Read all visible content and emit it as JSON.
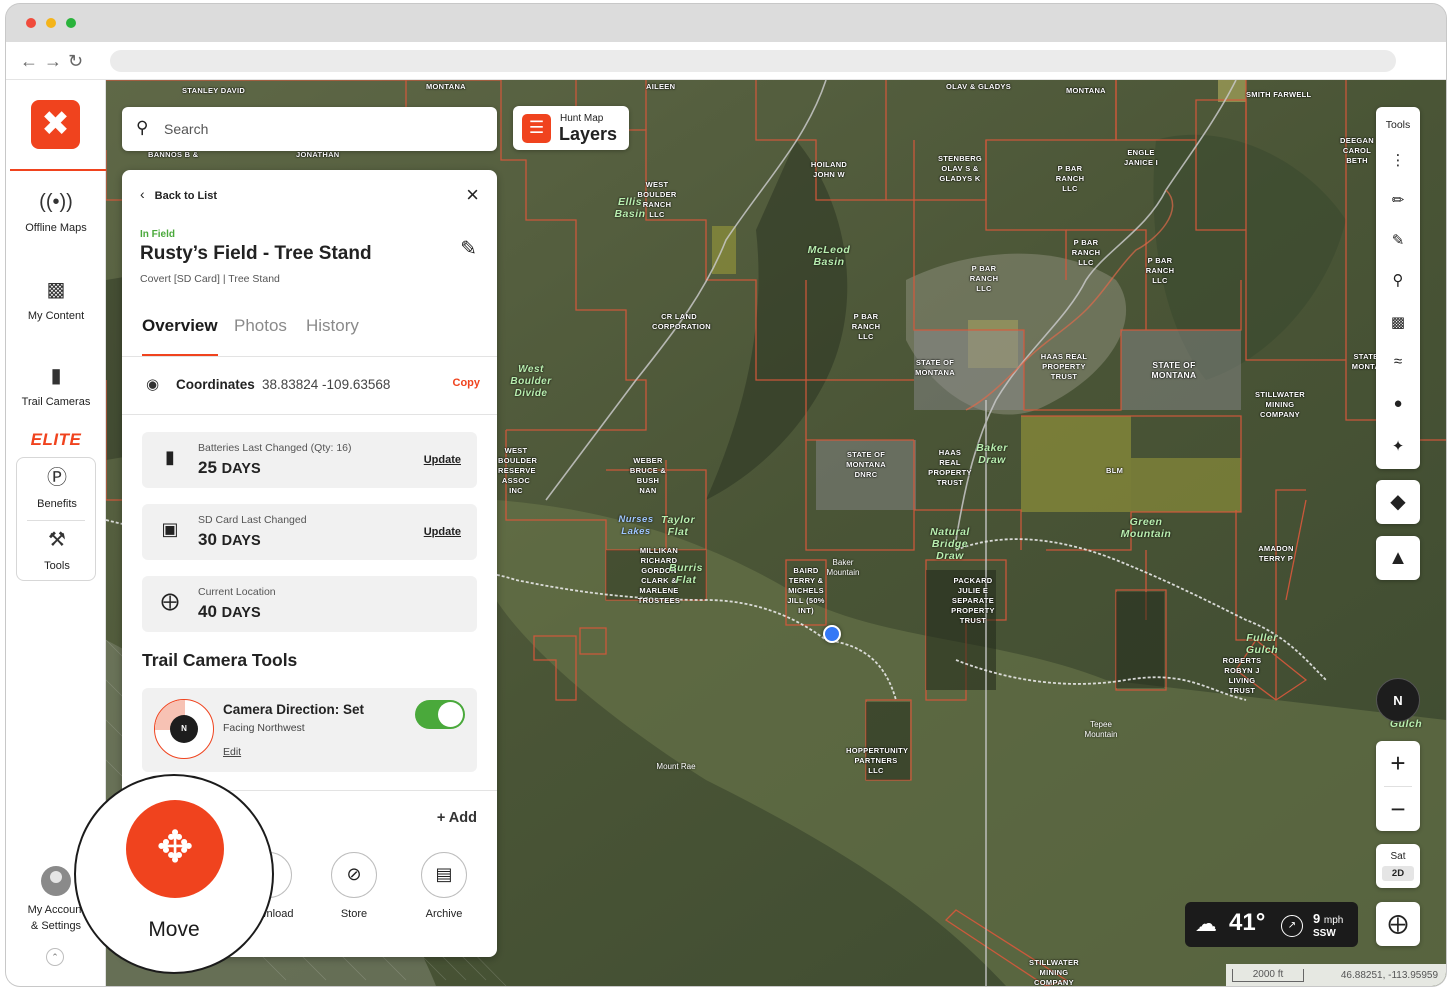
{
  "sidebar": {
    "items": [
      {
        "icon": "signal-icon",
        "label": "Offline Maps"
      },
      {
        "icon": "folder-icon",
        "label": "My Content"
      },
      {
        "icon": "trail-camera-icon",
        "label": "Trail Cameras"
      }
    ],
    "elite_label": "ELITE",
    "benefits_label": "Benefits",
    "tools_label": "Tools",
    "account_label_1": "My Account",
    "account_label_2": "& Settings"
  },
  "search": {
    "placeholder": "Search"
  },
  "layers": {
    "subtitle": "Hunt Map",
    "title": "Layers"
  },
  "detail": {
    "back_label": "Back to List",
    "status": "In Field",
    "title": "Rusty’s Field - Tree Stand",
    "subtitle": "Covert [SD Card] | Tree Stand",
    "tabs": [
      "Overview",
      "Photos",
      "History"
    ],
    "coordinates_label": "Coordinates",
    "coordinates_value": "38.83824  -109.63568",
    "copy_label": "Copy",
    "cards": [
      {
        "label": "Batteries Last Changed (Qty: 16)",
        "value": "25",
        "unit": "DAYS",
        "action": "Update"
      },
      {
        "label": "SD Card Last Changed",
        "value": "30",
        "unit": "DAYS",
        "action": "Update"
      },
      {
        "label": "Current Location",
        "value": "40",
        "unit": "DAYS",
        "action": ""
      }
    ],
    "tools_title": "Trail Camera Tools",
    "direction_title": "Camera Direction: Set",
    "direction_sub": "Facing Northwest",
    "direction_edit": "Edit",
    "compass_letter": "N",
    "add_label": "+ Add",
    "actions": [
      "Download",
      "Store",
      "Archive"
    ]
  },
  "move": {
    "label": "Move"
  },
  "tools_panel": {
    "title": "Tools"
  },
  "map_controls": {
    "north": "N",
    "sat_label": "Sat",
    "mode_2d": "2D",
    "zoom_in": "+",
    "zoom_out": "−"
  },
  "weather": {
    "temp": "41°",
    "speed": "9",
    "speed_unit": "mph",
    "direction": "SSW"
  },
  "scale": {
    "distance": "2000 ft",
    "cursor_coords": "46.88251, -113.95959"
  },
  "map_labels": [
    "STANLEY DAVID",
    "MONTANA",
    "AILEEN",
    "OLAV & GLADYS",
    "MONTANA",
    "SMITH FARWELL",
    "BANNOS B &",
    "JONATHAN",
    "HOILAND JOHN W",
    "STENBERG OLAV S & GLADYS K",
    "P BAR RANCH LLC",
    "ENGLE JANICE I",
    "DEEGAN CAROL BETH",
    "WEST BOULDER RANCH LLC",
    "P BAR RANCH LLC",
    "P BAR RANCH LLC",
    "P BAR RANCH LLC",
    "CR LAND CORPORATION",
    "P BAR RANCH LLC",
    "STATE OF MONTANA",
    "HAAS REAL PROPERTY TRUST",
    "STATE OF MONTANA",
    "STILLWATER MINING COMPANY",
    "STATE MONTA",
    "WEST BOULDER RESERVE ASSOC INC",
    "WEBER BRUCE & BUSH NAN",
    "STATE OF MONTANA DNRC",
    "HAAS REAL PROPERTY TRUST",
    "BLM",
    "MILLIKAN RICHARD GORDON CLARK & MARLENE TRUSTEES",
    "BAIRD TERRY & MICHELS JILL (50% INT)",
    "PACKARD JULIE E SEPARATE PROPERTY TRUST",
    "AMADON TERRY P",
    "ROBERTS ROBYN J LIVING TRUST",
    "HOPPERTUNITY PARTNERS LLC",
    "STILLWATER MINING COMPANY"
  ],
  "map_place_names": [
    "Ellis Basin",
    "McLeod Basin",
    "West Boulder Divide",
    "Nurses Lakes",
    "Taylor Flat",
    "Burris Flat",
    "Baker Draw",
    "Natural Bridge Draw",
    "Green Mountain",
    "Fuller Gulch",
    "Gulch"
  ],
  "map_terrain_names": [
    "Baker Mountain",
    "Tepee Mountain",
    "Mount Rae"
  ],
  "colors": {
    "accent": "#f0431e",
    "toggle_on": "#4aa93b",
    "status_green": "#4aa93b"
  }
}
